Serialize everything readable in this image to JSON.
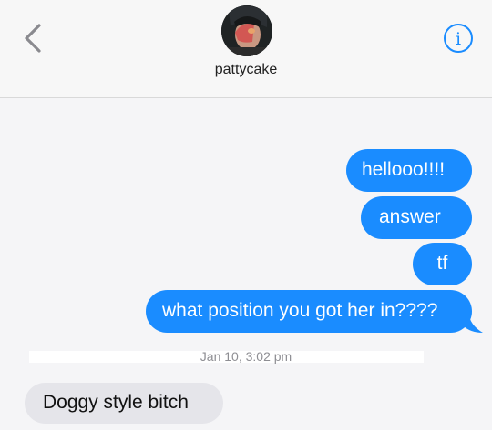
{
  "header": {
    "contact_name": "pattycake",
    "back_icon": "chevron-left-icon",
    "info_icon": "info-icon"
  },
  "messages": [
    {
      "direction": "outgoing",
      "text": "hellooo!!!!"
    },
    {
      "direction": "outgoing",
      "text": "answer"
    },
    {
      "direction": "outgoing",
      "text": "tf"
    },
    {
      "direction": "outgoing",
      "text": "what position you got her in????"
    },
    {
      "direction": "incoming",
      "text": "Doggy style bitch"
    }
  ],
  "timestamp": "Jan 10, 3:02 pm",
  "colors": {
    "accent": "#1a8cff",
    "incoming_bubble": "#e5e5ea",
    "timestamp_text": "#8e8e93"
  }
}
